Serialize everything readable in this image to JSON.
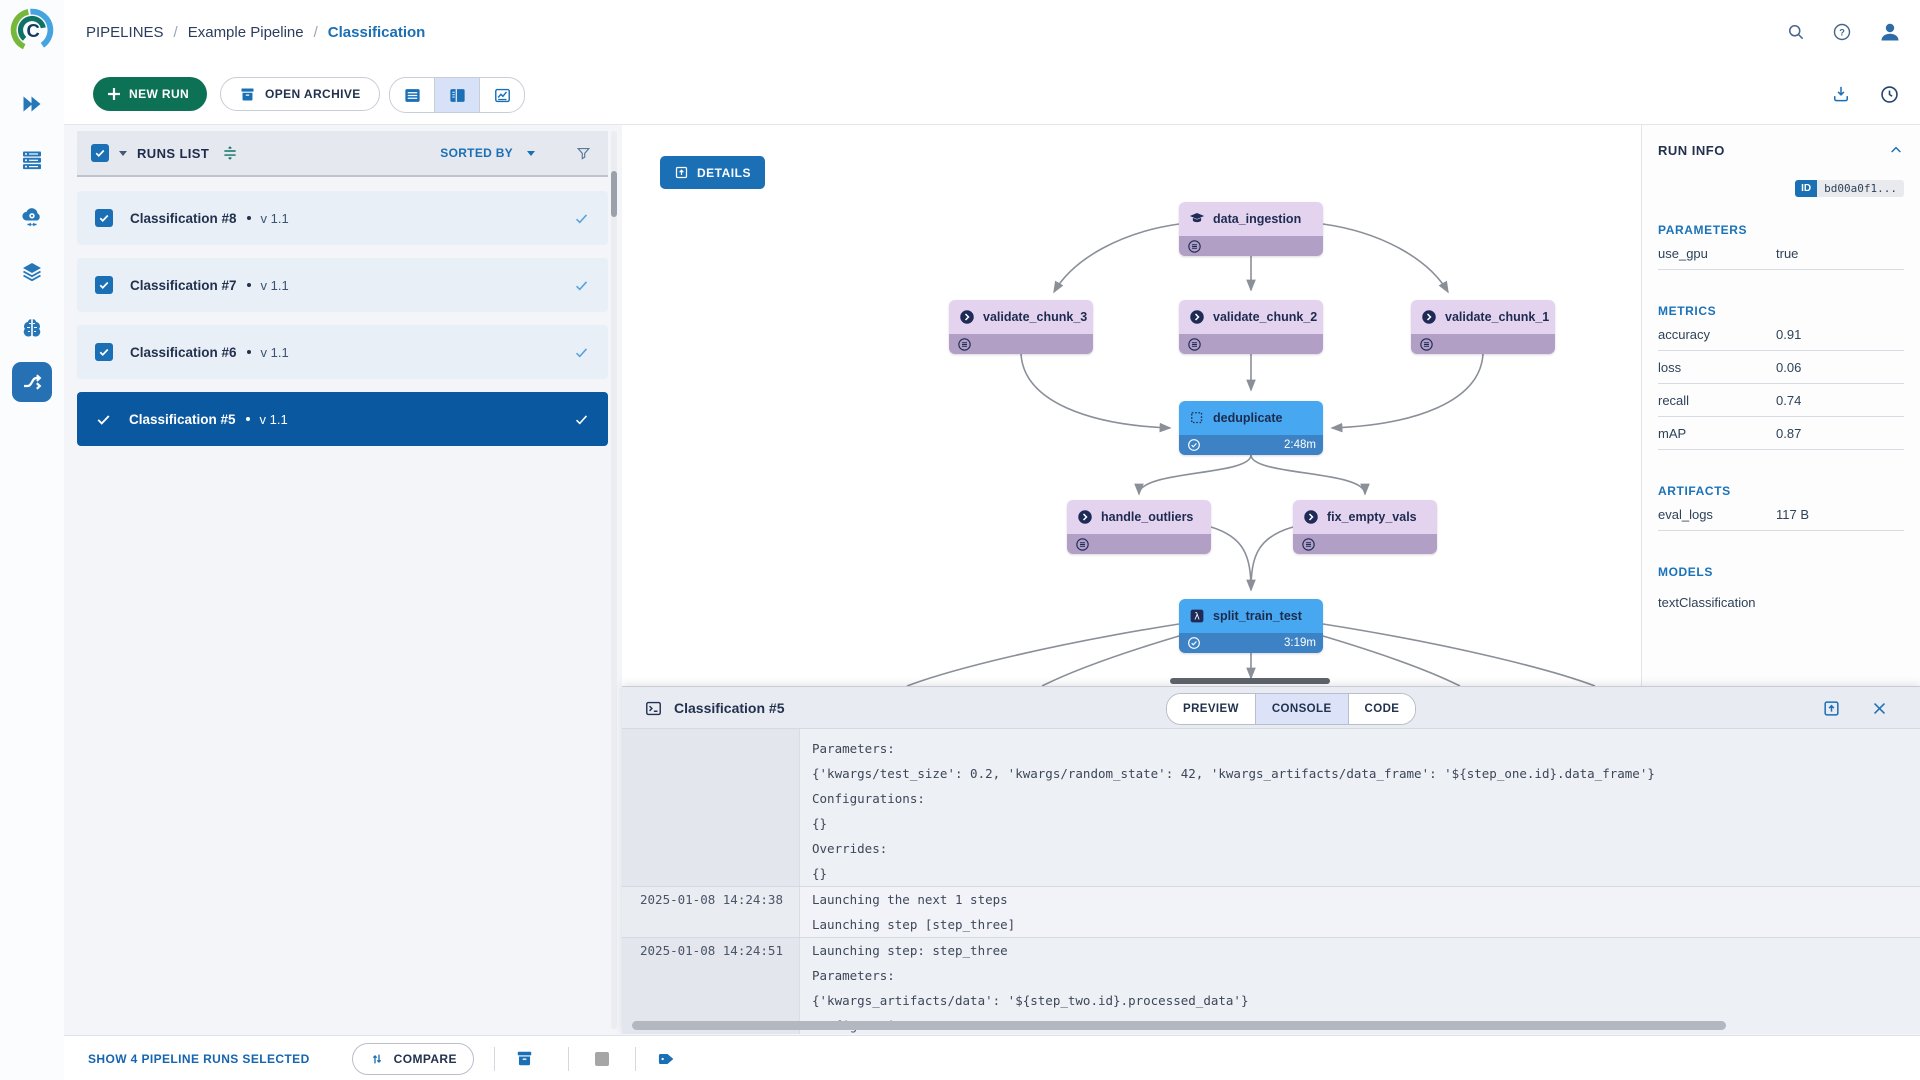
{
  "breadcrumb": {
    "section": "PIPELINES",
    "project": "Example Pipeline",
    "current": "Classification",
    "sep": "/"
  },
  "toolbar": {
    "new_run": "NEW RUN",
    "open_archive": "OPEN ARCHIVE"
  },
  "runs": {
    "title": "RUNS LIST",
    "sorted_by": "SORTED BY",
    "items": [
      {
        "name": "Classification #8",
        "version": "v 1.1"
      },
      {
        "name": "Classification #7",
        "version": "v 1.1"
      },
      {
        "name": "Classification #6",
        "version": "v 1.1"
      },
      {
        "name": "Classification #5",
        "version": "v 1.1"
      }
    ]
  },
  "dag": {
    "details": "DETAILS",
    "nodes": {
      "ingestion": {
        "label": "data_ingestion"
      },
      "chunk3": {
        "label": "validate_chunk_3"
      },
      "chunk2": {
        "label": "validate_chunk_2"
      },
      "chunk1": {
        "label": "validate_chunk_1"
      },
      "dedup": {
        "label": "deduplicate",
        "duration": "2:48m"
      },
      "outliers": {
        "label": "handle_outliers"
      },
      "fixvals": {
        "label": "fix_empty_vals"
      },
      "split": {
        "label": "split_train_test",
        "duration": "3:19m"
      }
    }
  },
  "info": {
    "title": "RUN INFO",
    "id_label": "ID",
    "id_value": "bd00a0f1...",
    "parameters_heading": "PARAMETERS",
    "parameters": [
      {
        "label": "use_gpu",
        "value": "true"
      }
    ],
    "metrics_heading": "METRICS",
    "metrics": [
      {
        "label": "accuracy",
        "value": "0.91"
      },
      {
        "label": "loss",
        "value": "0.06"
      },
      {
        "label": "recall",
        "value": "0.74"
      },
      {
        "label": "mAP",
        "value": "0.87"
      }
    ],
    "artifacts_heading": "ARTIFACTS",
    "artifacts": [
      {
        "label": "eval_logs",
        "value": "117 B"
      }
    ],
    "models_heading": "MODELS",
    "models": [
      "textClassification"
    ]
  },
  "console": {
    "title": "Classification #5",
    "tabs": [
      "PREVIEW",
      "CONSOLE",
      "CODE"
    ],
    "blocks": [
      {
        "timestamp": "",
        "lines": [
          "Parameters:",
          "{'kwargs/test_size': 0.2, 'kwargs/random_state': 42, 'kwargs_artifacts/data_frame': '${step_one.id}.data_frame'}",
          "Configurations:",
          "{}",
          "Overrides:",
          "{}"
        ]
      },
      {
        "timestamp": "2025-01-08 14:24:38",
        "lines": [
          "Launching the next 1 steps",
          "Launching step [step_three]"
        ]
      },
      {
        "timestamp": "2025-01-08 14:24:51",
        "lines": [
          "Launching step: step_three",
          "Parameters:",
          "{'kwargs_artifacts/data': '${step_two.id}.processed_data'}",
          "Configurations:"
        ]
      }
    ]
  },
  "footer": {
    "selection": "SHOW 4 PIPELINE RUNS SELECTED",
    "compare": "COMPARE"
  }
}
